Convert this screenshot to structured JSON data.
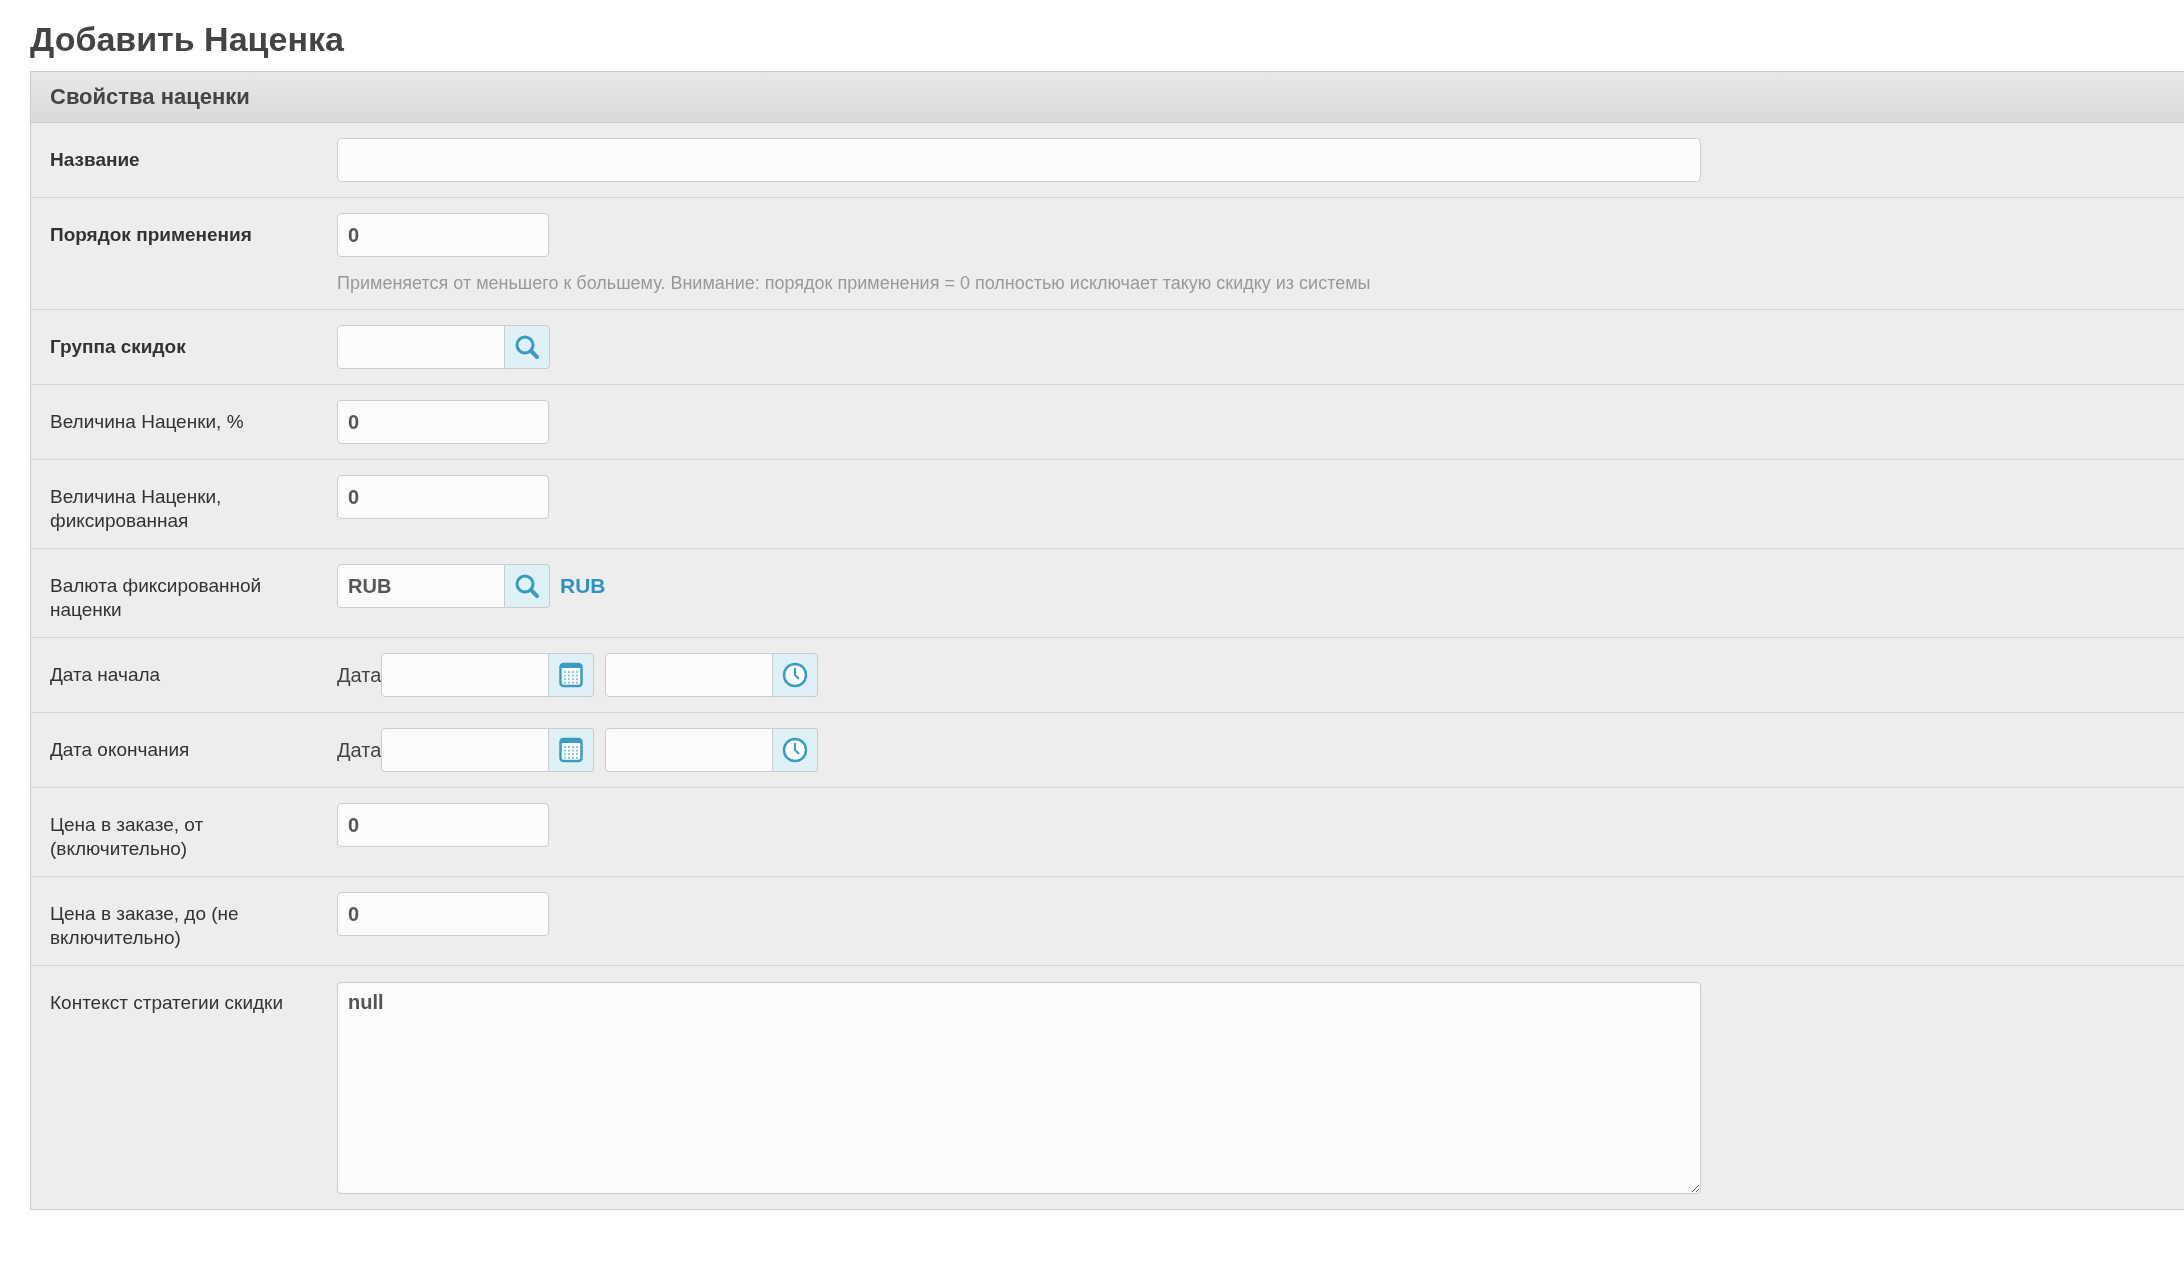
{
  "page_title": "Добавить Наценка",
  "panel": {
    "title": "Свойства наценки",
    "rows": [
      {
        "label": "Название",
        "required": true,
        "kind": "text_wide",
        "value": ""
      },
      {
        "label": "Порядок применения",
        "required": true,
        "kind": "text",
        "value": "0",
        "hint": "Применяется от меньшего к большему. Внимание: порядок применения = 0 полностью исключает такую скидку из системы"
      },
      {
        "label": "Группа скидок",
        "required": true,
        "kind": "lookup",
        "value": ""
      },
      {
        "label": "Величина Наценки, %",
        "required": false,
        "kind": "text",
        "value": "0"
      },
      {
        "label": "Величина Наценки, фиксированная",
        "required": false,
        "kind": "text",
        "value": "0"
      },
      {
        "label": "Валюта фиксированной наценки",
        "required": false,
        "kind": "lookup",
        "value": "RUB",
        "link": "RUB"
      },
      {
        "label": "Дата начала",
        "required": false,
        "kind": "datetime",
        "date_label": "Дата"
      },
      {
        "label": "Дата окончания",
        "required": false,
        "kind": "datetime",
        "date_label": "Дата"
      },
      {
        "label": "Цена в заказе, от (включительно)",
        "required": false,
        "kind": "text",
        "value": "0"
      },
      {
        "label": "Цена в заказе, до (не включительно)",
        "required": false,
        "kind": "text",
        "value": "0"
      },
      {
        "label": "Контекст стратегии скидки",
        "required": false,
        "kind": "textarea",
        "value": "null"
      }
    ]
  }
}
